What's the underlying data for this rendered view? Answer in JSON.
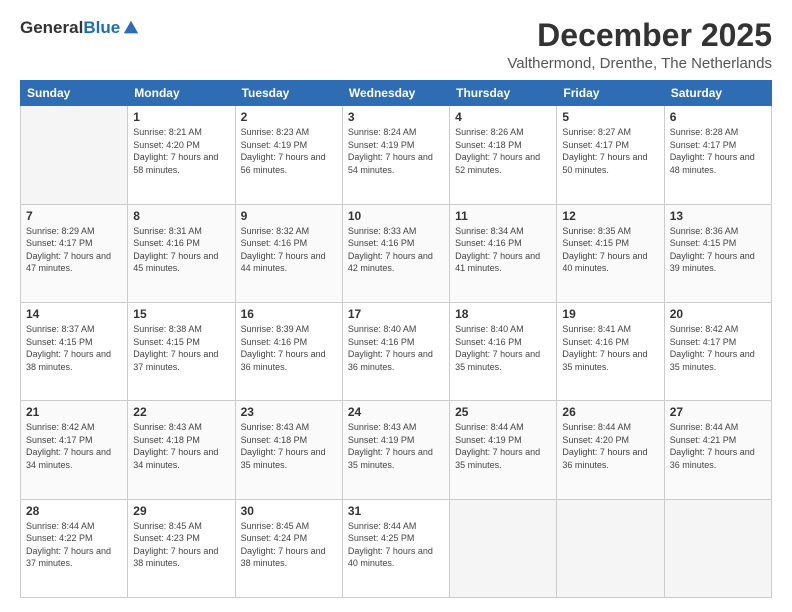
{
  "logo": {
    "general": "General",
    "blue": "Blue"
  },
  "header": {
    "month": "December 2025",
    "location": "Valthermond, Drenthe, The Netherlands"
  },
  "weekdays": [
    "Sunday",
    "Monday",
    "Tuesday",
    "Wednesday",
    "Thursday",
    "Friday",
    "Saturday"
  ],
  "weeks": [
    [
      {
        "day": "",
        "empty": true
      },
      {
        "day": "1",
        "sunrise": "Sunrise: 8:21 AM",
        "sunset": "Sunset: 4:20 PM",
        "daylight": "Daylight: 7 hours and 58 minutes."
      },
      {
        "day": "2",
        "sunrise": "Sunrise: 8:23 AM",
        "sunset": "Sunset: 4:19 PM",
        "daylight": "Daylight: 7 hours and 56 minutes."
      },
      {
        "day": "3",
        "sunrise": "Sunrise: 8:24 AM",
        "sunset": "Sunset: 4:19 PM",
        "daylight": "Daylight: 7 hours and 54 minutes."
      },
      {
        "day": "4",
        "sunrise": "Sunrise: 8:26 AM",
        "sunset": "Sunset: 4:18 PM",
        "daylight": "Daylight: 7 hours and 52 minutes."
      },
      {
        "day": "5",
        "sunrise": "Sunrise: 8:27 AM",
        "sunset": "Sunset: 4:17 PM",
        "daylight": "Daylight: 7 hours and 50 minutes."
      },
      {
        "day": "6",
        "sunrise": "Sunrise: 8:28 AM",
        "sunset": "Sunset: 4:17 PM",
        "daylight": "Daylight: 7 hours and 48 minutes."
      }
    ],
    [
      {
        "day": "7",
        "sunrise": "Sunrise: 8:29 AM",
        "sunset": "Sunset: 4:17 PM",
        "daylight": "Daylight: 7 hours and 47 minutes."
      },
      {
        "day": "8",
        "sunrise": "Sunrise: 8:31 AM",
        "sunset": "Sunset: 4:16 PM",
        "daylight": "Daylight: 7 hours and 45 minutes."
      },
      {
        "day": "9",
        "sunrise": "Sunrise: 8:32 AM",
        "sunset": "Sunset: 4:16 PM",
        "daylight": "Daylight: 7 hours and 44 minutes."
      },
      {
        "day": "10",
        "sunrise": "Sunrise: 8:33 AM",
        "sunset": "Sunset: 4:16 PM",
        "daylight": "Daylight: 7 hours and 42 minutes."
      },
      {
        "day": "11",
        "sunrise": "Sunrise: 8:34 AM",
        "sunset": "Sunset: 4:16 PM",
        "daylight": "Daylight: 7 hours and 41 minutes."
      },
      {
        "day": "12",
        "sunrise": "Sunrise: 8:35 AM",
        "sunset": "Sunset: 4:15 PM",
        "daylight": "Daylight: 7 hours and 40 minutes."
      },
      {
        "day": "13",
        "sunrise": "Sunrise: 8:36 AM",
        "sunset": "Sunset: 4:15 PM",
        "daylight": "Daylight: 7 hours and 39 minutes."
      }
    ],
    [
      {
        "day": "14",
        "sunrise": "Sunrise: 8:37 AM",
        "sunset": "Sunset: 4:15 PM",
        "daylight": "Daylight: 7 hours and 38 minutes."
      },
      {
        "day": "15",
        "sunrise": "Sunrise: 8:38 AM",
        "sunset": "Sunset: 4:15 PM",
        "daylight": "Daylight: 7 hours and 37 minutes."
      },
      {
        "day": "16",
        "sunrise": "Sunrise: 8:39 AM",
        "sunset": "Sunset: 4:16 PM",
        "daylight": "Daylight: 7 hours and 36 minutes."
      },
      {
        "day": "17",
        "sunrise": "Sunrise: 8:40 AM",
        "sunset": "Sunset: 4:16 PM",
        "daylight": "Daylight: 7 hours and 36 minutes."
      },
      {
        "day": "18",
        "sunrise": "Sunrise: 8:40 AM",
        "sunset": "Sunset: 4:16 PM",
        "daylight": "Daylight: 7 hours and 35 minutes."
      },
      {
        "day": "19",
        "sunrise": "Sunrise: 8:41 AM",
        "sunset": "Sunset: 4:16 PM",
        "daylight": "Daylight: 7 hours and 35 minutes."
      },
      {
        "day": "20",
        "sunrise": "Sunrise: 8:42 AM",
        "sunset": "Sunset: 4:17 PM",
        "daylight": "Daylight: 7 hours and 35 minutes."
      }
    ],
    [
      {
        "day": "21",
        "sunrise": "Sunrise: 8:42 AM",
        "sunset": "Sunset: 4:17 PM",
        "daylight": "Daylight: 7 hours and 34 minutes."
      },
      {
        "day": "22",
        "sunrise": "Sunrise: 8:43 AM",
        "sunset": "Sunset: 4:18 PM",
        "daylight": "Daylight: 7 hours and 34 minutes."
      },
      {
        "day": "23",
        "sunrise": "Sunrise: 8:43 AM",
        "sunset": "Sunset: 4:18 PM",
        "daylight": "Daylight: 7 hours and 35 minutes."
      },
      {
        "day": "24",
        "sunrise": "Sunrise: 8:43 AM",
        "sunset": "Sunset: 4:19 PM",
        "daylight": "Daylight: 7 hours and 35 minutes."
      },
      {
        "day": "25",
        "sunrise": "Sunrise: 8:44 AM",
        "sunset": "Sunset: 4:19 PM",
        "daylight": "Daylight: 7 hours and 35 minutes."
      },
      {
        "day": "26",
        "sunrise": "Sunrise: 8:44 AM",
        "sunset": "Sunset: 4:20 PM",
        "daylight": "Daylight: 7 hours and 36 minutes."
      },
      {
        "day": "27",
        "sunrise": "Sunrise: 8:44 AM",
        "sunset": "Sunset: 4:21 PM",
        "daylight": "Daylight: 7 hours and 36 minutes."
      }
    ],
    [
      {
        "day": "28",
        "sunrise": "Sunrise: 8:44 AM",
        "sunset": "Sunset: 4:22 PM",
        "daylight": "Daylight: 7 hours and 37 minutes."
      },
      {
        "day": "29",
        "sunrise": "Sunrise: 8:45 AM",
        "sunset": "Sunset: 4:23 PM",
        "daylight": "Daylight: 7 hours and 38 minutes."
      },
      {
        "day": "30",
        "sunrise": "Sunrise: 8:45 AM",
        "sunset": "Sunset: 4:24 PM",
        "daylight": "Daylight: 7 hours and 38 minutes."
      },
      {
        "day": "31",
        "sunrise": "Sunrise: 8:44 AM",
        "sunset": "Sunset: 4:25 PM",
        "daylight": "Daylight: 7 hours and 40 minutes."
      },
      {
        "day": "",
        "empty": true
      },
      {
        "day": "",
        "empty": true
      },
      {
        "day": "",
        "empty": true
      }
    ]
  ]
}
